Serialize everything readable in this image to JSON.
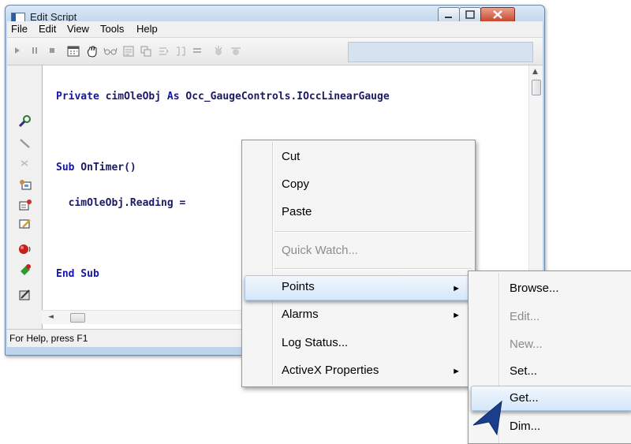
{
  "window": {
    "title": "Edit Script",
    "menus": [
      "File",
      "Edit",
      "View",
      "Tools",
      "Help"
    ]
  },
  "code": {
    "line1_kw": "Private",
    "line1_rest": " cimOleObj ",
    "line1_kw2": "As",
    "line1_type": " Occ_GaugeControls.IOccLinearGauge",
    "line2_kw": "Sub",
    "line2_rest": " OnTimer()",
    "line3": "  cimOleObj.Reading =",
    "line4_kw": "End Sub"
  },
  "status": {
    "text": "For Help, press F1"
  },
  "context_menu": {
    "items": [
      {
        "label": "Cut",
        "enabled": true
      },
      {
        "label": "Copy",
        "enabled": true
      },
      {
        "label": "Paste",
        "enabled": true
      },
      {
        "label": "Quick Watch...",
        "enabled": false
      },
      {
        "label": "Points",
        "enabled": true,
        "submenu": true,
        "highlighted": true
      },
      {
        "label": "Alarms",
        "enabled": true,
        "submenu": true
      },
      {
        "label": "Log Status...",
        "enabled": true
      },
      {
        "label": "ActiveX Properties",
        "enabled": true,
        "submenu": true
      }
    ]
  },
  "points_submenu": {
    "items": [
      {
        "label": "Browse...",
        "enabled": true
      },
      {
        "label": "Edit...",
        "enabled": false
      },
      {
        "label": "New...",
        "enabled": false
      },
      {
        "label": "Set...",
        "enabled": true
      },
      {
        "label": "Get...",
        "enabled": true,
        "highlighted": true
      },
      {
        "label": "Dim...",
        "enabled": true
      }
    ]
  },
  "colors": {
    "accent": "#1a3e8c",
    "highlight": "#d5e7f9",
    "keyword": "#1515a8",
    "disabled": "#8c8c8c"
  }
}
